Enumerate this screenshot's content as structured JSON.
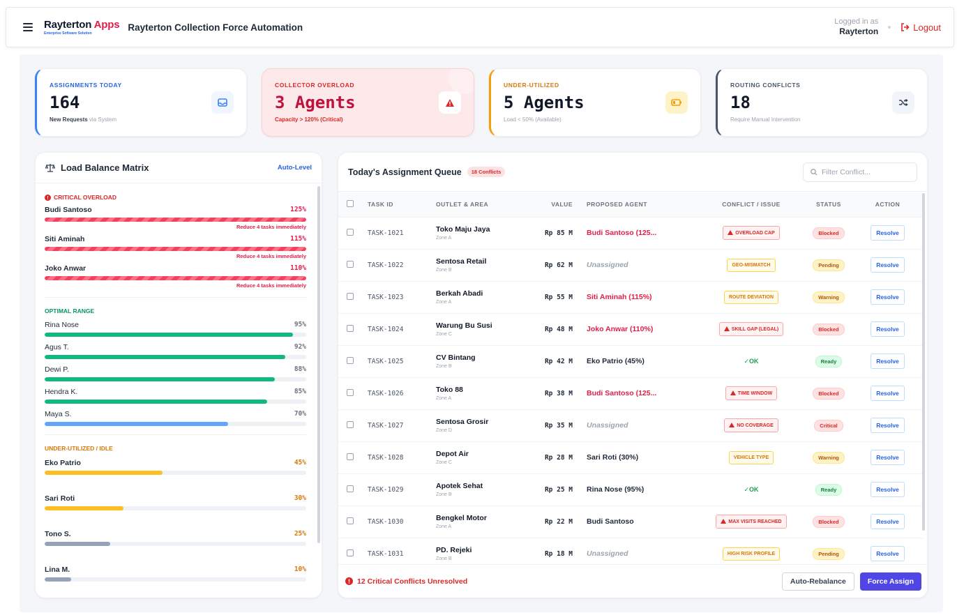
{
  "header": {
    "brand_main": "Rayterton",
    "brand_accent": "Apps",
    "brand_tagline": "Enterprise Software Solution",
    "app_title": "Rayterton Collection Force Automation",
    "logged_in_label": "Logged in as",
    "user": "Rayterton",
    "logout_label": "Logout"
  },
  "kpis": [
    {
      "label": "ASSIGNMENTS TODAY",
      "value": "164",
      "sub_strong": "New Requests",
      "sub": " via System",
      "icon": "inbox-icon"
    },
    {
      "label": "COLLECTOR OVERLOAD",
      "value": "3 Agents",
      "sub_strong": "",
      "sub": "Capacity > 120% (Critical)",
      "icon": "warning-icon"
    },
    {
      "label": "UNDER-UTILIZED",
      "value": "5 Agents",
      "sub_strong": "",
      "sub": "Load < 50% (Available)",
      "icon": "battery-low-icon"
    },
    {
      "label": "ROUTING CONFLICTS",
      "value": "18",
      "sub_strong": "",
      "sub": "Require Manual Intervention",
      "icon": "shuffle-icon"
    }
  ],
  "load_balance": {
    "title": "Load Balance Matrix",
    "action": "Auto-Level",
    "critical_title": "CRITICAL OVERLOAD",
    "critical": [
      {
        "name": "Budi Santoso",
        "pct": "125%",
        "note": "Reduce 4 tasks immediately"
      },
      {
        "name": "Siti Aminah",
        "pct": "115%",
        "note": "Reduce 4 tasks immediately"
      },
      {
        "name": "Joko Anwar",
        "pct": "110%",
        "note": "Reduce 4 tasks immediately"
      }
    ],
    "optimal_title": "OPTIMAL RANGE",
    "optimal": [
      {
        "name": "Rina Nose",
        "pct": "95%",
        "fill": 95,
        "color": "#10b981"
      },
      {
        "name": "Agus T.",
        "pct": "92%",
        "fill": 92,
        "color": "#10b981"
      },
      {
        "name": "Dewi P.",
        "pct": "88%",
        "fill": 88,
        "color": "#10b981"
      },
      {
        "name": "Hendra K.",
        "pct": "85%",
        "fill": 85,
        "color": "#10b981"
      },
      {
        "name": "Maya S.",
        "pct": "70%",
        "fill": 70,
        "color": "#60a5fa"
      }
    ],
    "under_title": "UNDER-UTILIZED / IDLE",
    "under": [
      {
        "name": "Eko Patrio",
        "pct": "45%",
        "fill": 45,
        "color": "#fbbf24"
      },
      {
        "name": "Sari Roti",
        "pct": "30%",
        "fill": 30,
        "color": "#fbbf24"
      },
      {
        "name": "Tono S.",
        "pct": "25%",
        "fill": 25,
        "color": "#94a3b8"
      },
      {
        "name": "Lina M.",
        "pct": "10%",
        "fill": 10,
        "color": "#94a3b8"
      }
    ]
  },
  "queue": {
    "title": "Today's Assignment Queue",
    "badge": "18 Conflicts",
    "filter_placeholder": "Filter Conflict...",
    "columns": [
      "TASK ID",
      "OUTLET & AREA",
      "VALUE",
      "PROPOSED AGENT",
      "CONFLICT / ISSUE",
      "STATUS",
      "ACTION"
    ],
    "rows": [
      {
        "id": "TASK-1021",
        "outlet": "Toko Maju Jaya",
        "zone": "Zone A",
        "value": "Rp 85 M",
        "agent": "Budi Santoso (125...",
        "agent_style": "red",
        "conflict": "OVERLOAD CAP",
        "conflict_style": "red",
        "conflict_icon": true,
        "status": "Blocked",
        "action": "Resolve"
      },
      {
        "id": "TASK-1022",
        "outlet": "Sentosa Retail",
        "zone": "Zone B",
        "value": "Rp 62 M",
        "agent": "Unassigned",
        "agent_style": "un",
        "conflict": "GEO-MISMATCH",
        "conflict_style": "amber",
        "conflict_icon": false,
        "status": "Pending",
        "action": "Resolve"
      },
      {
        "id": "TASK-1023",
        "outlet": "Berkah Abadi",
        "zone": "Zone A",
        "value": "Rp 55 M",
        "agent": "Siti Aminah (115%)",
        "agent_style": "red",
        "conflict": "ROUTE DEVIATION",
        "conflict_style": "amber",
        "conflict_icon": false,
        "status": "Warning",
        "action": "Resolve"
      },
      {
        "id": "TASK-1024",
        "outlet": "Warung Bu Susi",
        "zone": "Zone C",
        "value": "Rp 48 M",
        "agent": "Joko Anwar (110%)",
        "agent_style": "red",
        "conflict": "SKILL GAP (LEGAL)",
        "conflict_style": "red",
        "conflict_icon": true,
        "status": "Blocked",
        "action": "Resolve"
      },
      {
        "id": "TASK-1025",
        "outlet": "CV Bintang",
        "zone": "Zone B",
        "value": "Rp 42 M",
        "agent": "Eko Patrio (45%)",
        "agent_style": "normal",
        "conflict": "OK",
        "conflict_style": "ok",
        "conflict_icon": false,
        "status": "Ready",
        "action": "Resolve"
      },
      {
        "id": "TASK-1026",
        "outlet": "Toko 88",
        "zone": "Zone A",
        "value": "Rp 38 M",
        "agent": "Budi Santoso (125...",
        "agent_style": "red",
        "conflict": "TIME WINDOW",
        "conflict_style": "red",
        "conflict_icon": true,
        "status": "Blocked",
        "action": "Resolve"
      },
      {
        "id": "TASK-1027",
        "outlet": "Sentosa Grosir",
        "zone": "Zone D",
        "value": "Rp 35 M",
        "agent": "Unassigned",
        "agent_style": "un",
        "conflict": "NO COVERAGE",
        "conflict_style": "red",
        "conflict_icon": true,
        "status": "Critical",
        "action": "Resolve"
      },
      {
        "id": "TASK-1028",
        "outlet": "Depot Air",
        "zone": "Zone C",
        "value": "Rp 28 M",
        "agent": "Sari Roti (30%)",
        "agent_style": "normal",
        "conflict": "VEHICLE TYPE",
        "conflict_style": "amber",
        "conflict_icon": false,
        "status": "Warning",
        "action": "Resolve"
      },
      {
        "id": "TASK-1029",
        "outlet": "Apotek Sehat",
        "zone": "Zone B",
        "value": "Rp 25 M",
        "agent": "Rina Nose (95%)",
        "agent_style": "normal",
        "conflict": "OK",
        "conflict_style": "ok",
        "conflict_icon": false,
        "status": "Ready",
        "action": "Resolve"
      },
      {
        "id": "TASK-1030",
        "outlet": "Bengkel Motor",
        "zone": "Zone A",
        "value": "Rp 22 M",
        "agent": "Budi Santoso",
        "agent_style": "normal",
        "conflict": "MAX VISITS REACHED",
        "conflict_style": "red",
        "conflict_icon": true,
        "status": "Blocked",
        "action": "Resolve"
      },
      {
        "id": "TASK-1031",
        "outlet": "PD. Rejeki",
        "zone": "Zone B",
        "value": "Rp 18 M",
        "agent": "Unassigned",
        "agent_style": "un",
        "conflict": "HIGH RISK PROFILE",
        "conflict_style": "amber",
        "conflict_icon": false,
        "status": "Pending",
        "action": "Resolve"
      }
    ],
    "footer_warning": "12 Critical Conflicts Unresolved",
    "btn_rebalance": "Auto-Rebalance",
    "btn_force": "Force Assign"
  }
}
